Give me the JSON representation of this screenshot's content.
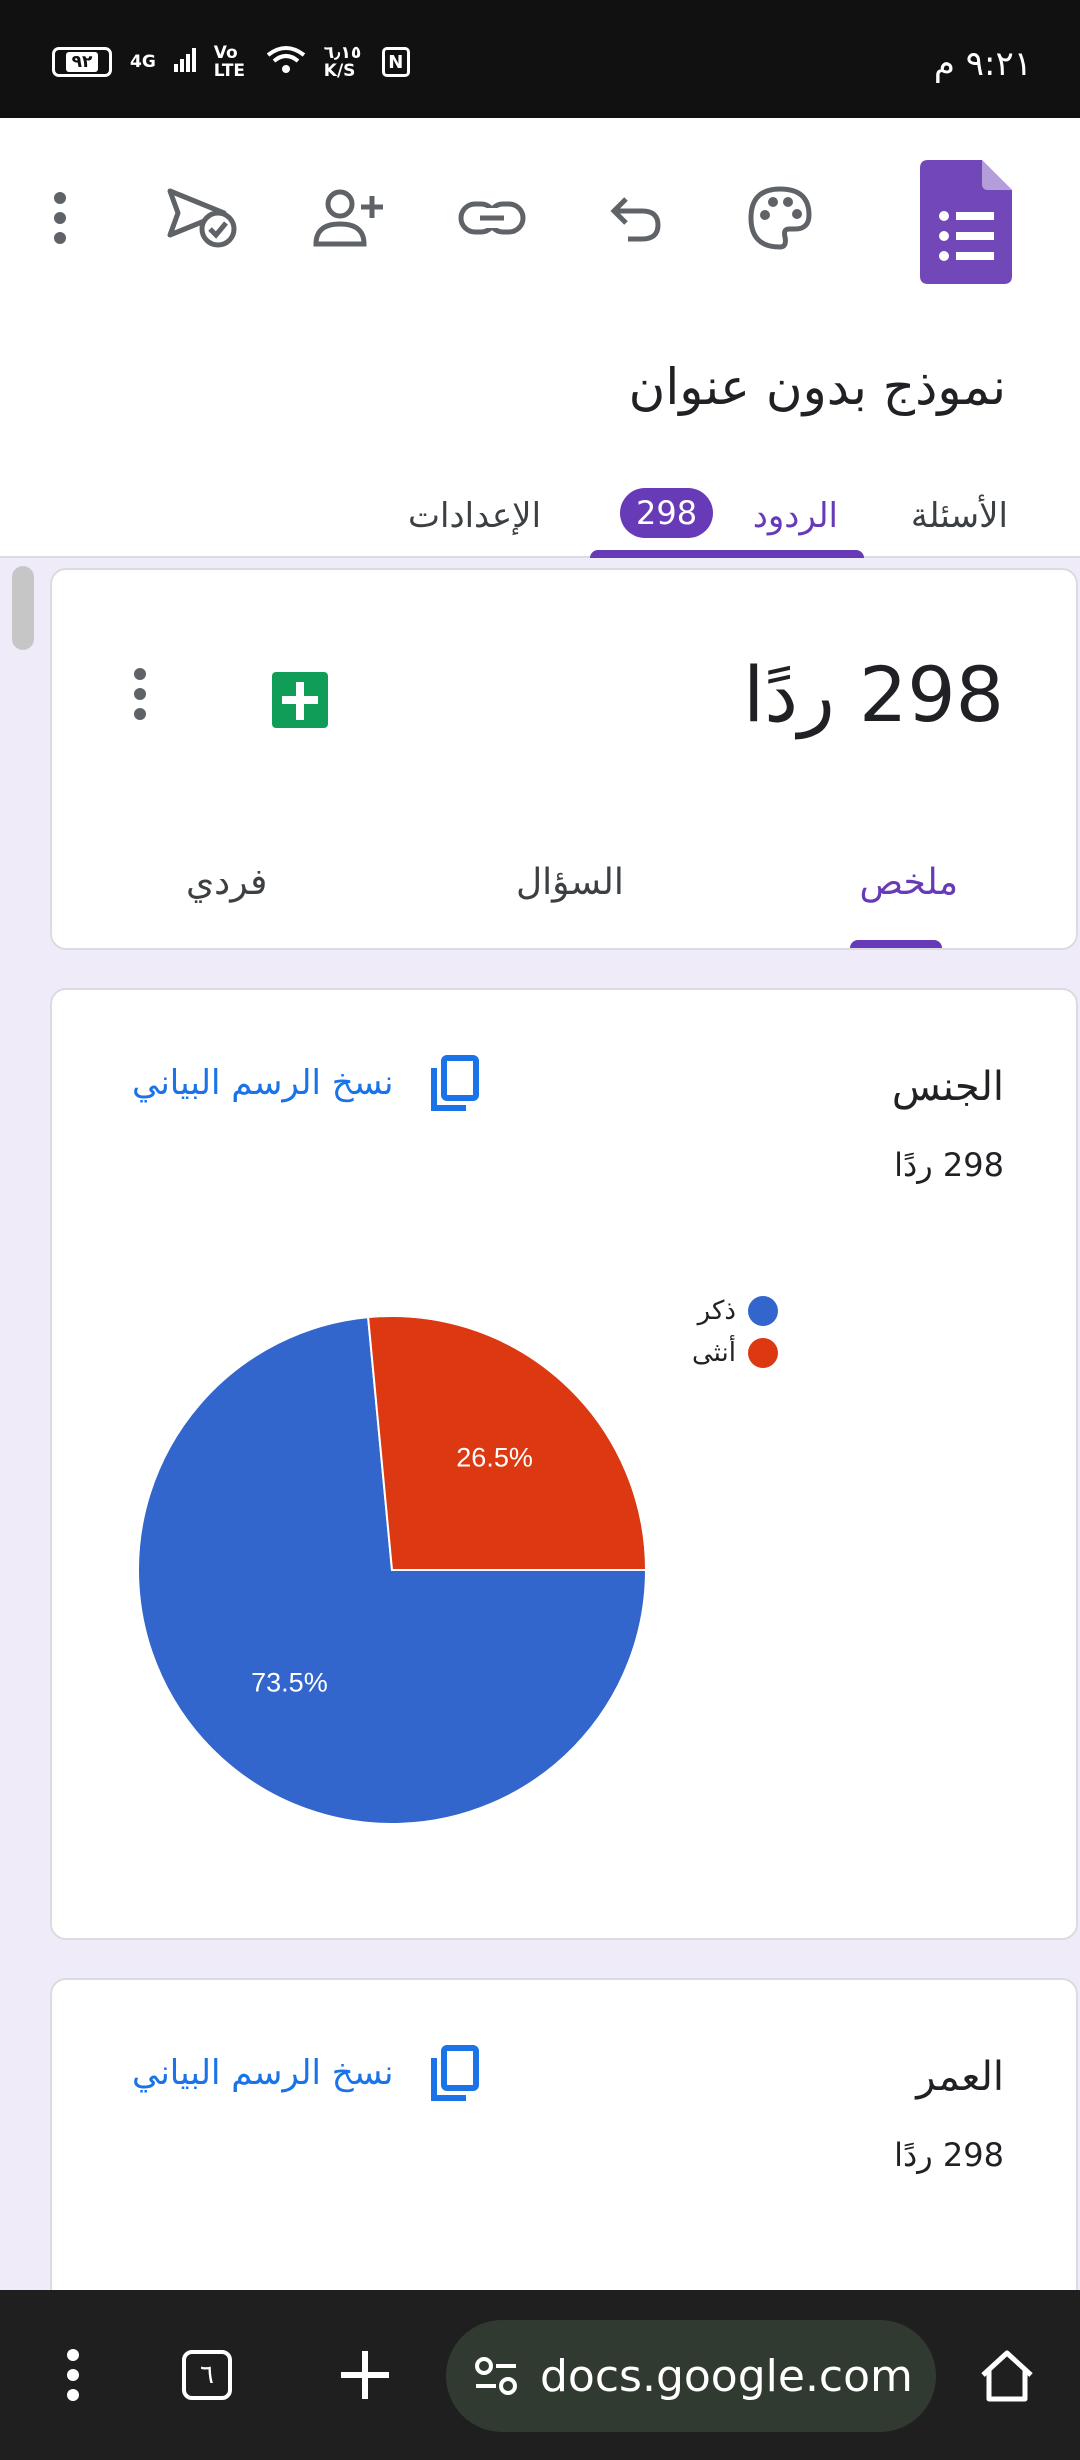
{
  "status_bar": {
    "time": "٩:٢١ م",
    "battery": "٩٢",
    "network": "4G",
    "volte": "Vo LTE",
    "speed": "٦٫١٥ K/S"
  },
  "header": {
    "form_title": "نموذج بدون عنوان",
    "tabs": {
      "questions": "الأسئلة",
      "responses": "الردود",
      "responses_badge": "298",
      "settings": "الإعدادات"
    }
  },
  "summary_card": {
    "count_title": "298 ردًا",
    "sub_tabs": {
      "summary": "ملخص",
      "question": "السؤال",
      "individual": "فردي"
    }
  },
  "gender_card": {
    "title": "الجنس",
    "count": "298 ردًا",
    "copy_label": "نسخ الرسم البياني",
    "legend": [
      {
        "label": "ذكر",
        "color": "#3366cc"
      },
      {
        "label": "أنثى",
        "color": "#dc3912"
      }
    ]
  },
  "age_card": {
    "title": "العمر",
    "count": "298 ردًا",
    "copy_label": "نسخ الرسم البياني"
  },
  "chart_data": {
    "type": "pie",
    "title": "الجنس",
    "categories": [
      "ذكر",
      "أنثى"
    ],
    "values": [
      73.5,
      26.5
    ],
    "labels": [
      "73.5%",
      "26.5%"
    ],
    "colors": [
      "#3366cc",
      "#dc3912"
    ],
    "legend_position": "top-right"
  },
  "bottom_bar": {
    "tab_count": "٦",
    "url": "docs.google.com"
  },
  "colors": {
    "accent": "#673ab7",
    "link": "#1a73e8",
    "background": "#f0ebf8"
  }
}
